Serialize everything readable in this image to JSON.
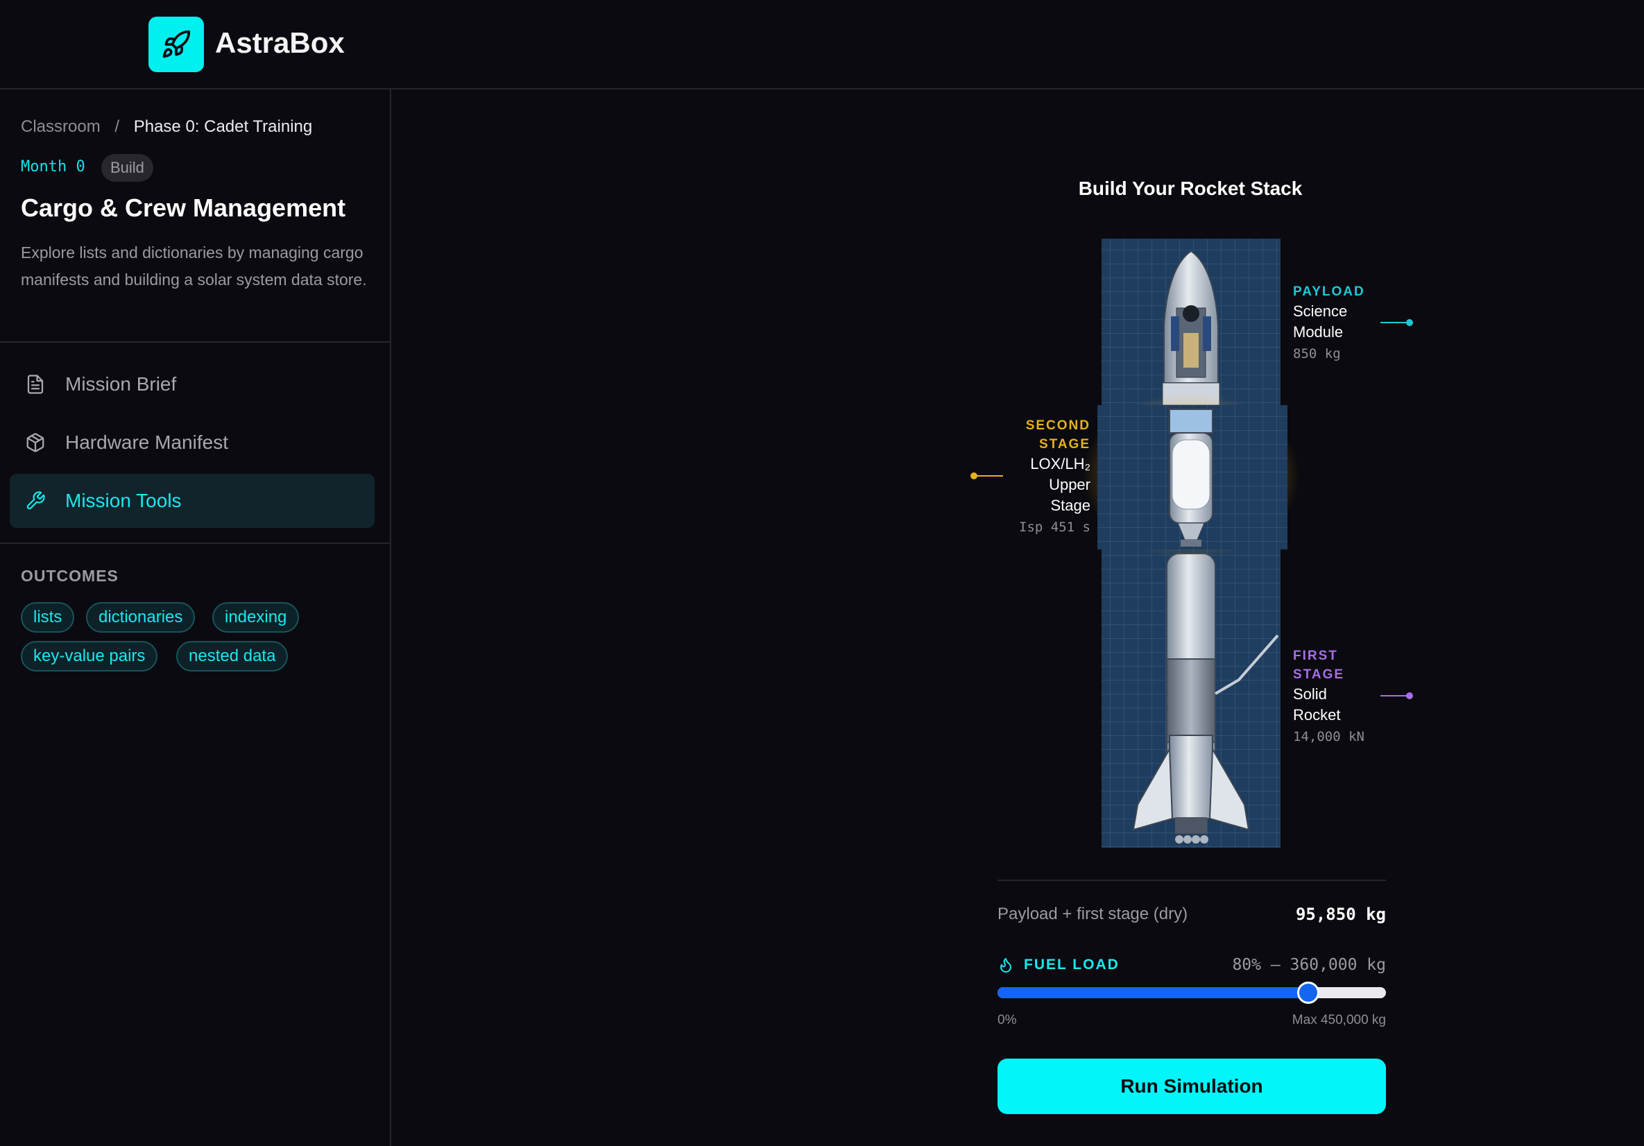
{
  "app": {
    "name": "AstraBox",
    "icon": "rocket-icon",
    "accent": "#00f0f0"
  },
  "breadcrumb": {
    "root": "Classroom",
    "separator": "/",
    "current": "Phase 0: Cadet Training"
  },
  "course": {
    "month": "Month 0",
    "badge": "Build",
    "title": "Cargo & Crew Management",
    "description": "Explore lists and dictionaries by managing cargo manifests and building a solar system data store."
  },
  "nav": {
    "items": [
      {
        "label": "Mission Brief",
        "icon": "document-icon"
      },
      {
        "label": "Hardware Manifest",
        "icon": "package-icon"
      },
      {
        "label": "Mission Tools",
        "icon": "wrench-icon",
        "active": true
      }
    ]
  },
  "outcomes": {
    "heading": "OUTCOMES",
    "tags": [
      "lists",
      "dictionaries",
      "indexing",
      "key-value pairs",
      "nested data"
    ]
  },
  "builder": {
    "title": "Build Your Rocket Stack",
    "stages": {
      "payload": {
        "category_line1": "PAYLOAD",
        "category_line2": "",
        "name_lines": [
          "Science",
          "Module"
        ],
        "spec": "850 kg",
        "color": "#1fc8d8"
      },
      "second": {
        "category_line1": "SECOND",
        "category_line2": "STAGE",
        "name_lines": [
          "LOX/LH₂",
          "Upper",
          "Stage"
        ],
        "spec": "Isp 451 s",
        "color": "#e6b21a"
      },
      "first": {
        "category_line1": "FIRST",
        "category_line2": "STAGE",
        "name_lines": [
          "Solid",
          "Rocket"
        ],
        "spec": "14,000 kN",
        "color": "#a86ee6"
      }
    },
    "stat": {
      "label": "Payload + first stage (dry)",
      "value": "95,850 kg"
    },
    "fuel": {
      "label": "FUEL LOAD",
      "icon": "flame-icon",
      "value_text": "80% — 360,000 kg",
      "percent": 80,
      "min_label": "0%",
      "max_label": "Max 450,000 kg"
    },
    "run_button": "Run Simulation"
  }
}
